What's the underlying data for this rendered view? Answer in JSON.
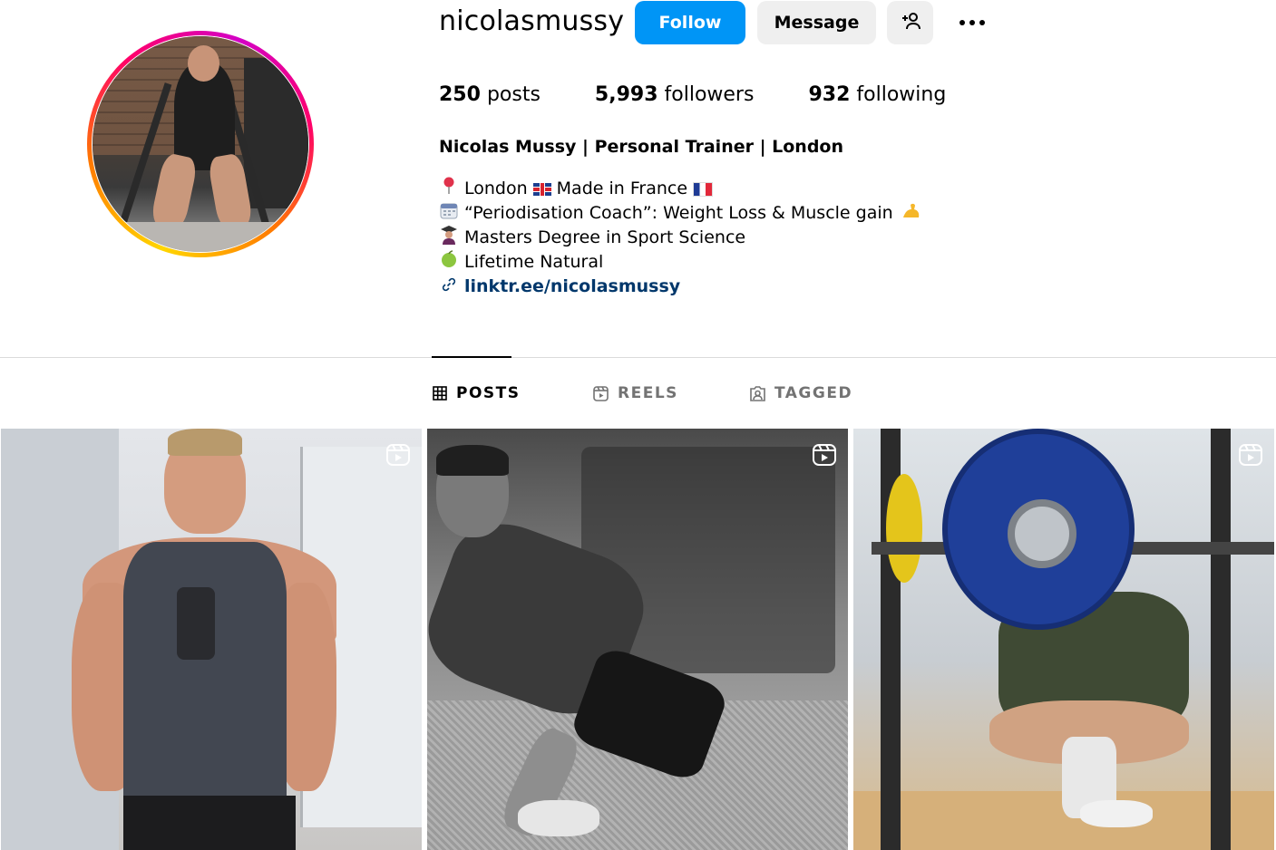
{
  "profile": {
    "username": "nicolasmussy",
    "full_name": "Nicolas Mussy | Personal Trainer | London"
  },
  "actions": {
    "follow": "Follow",
    "message": "Message"
  },
  "stats": [
    {
      "count": "250",
      "label": "posts"
    },
    {
      "count": "5,993",
      "label": "followers"
    },
    {
      "count": "932",
      "label": "following"
    }
  ],
  "bio": {
    "line1_a": "London",
    "line1_b": "Made in France",
    "line2": "“Periodisation Coach”: Weight Loss & Muscle gain",
    "line3": "Masters Degree in Sport Science",
    "line4": "Lifetime Natural",
    "link": "linktr.ee/nicolasmussy"
  },
  "tabs": [
    {
      "label": "POSTS",
      "icon": "grid-icon",
      "active": true
    },
    {
      "label": "REELS",
      "icon": "reels-icon",
      "active": false
    },
    {
      "label": "TAGGED",
      "icon": "tagged-icon",
      "active": false
    }
  ],
  "colors": {
    "follow_button": "#0095f6",
    "secondary_button": "#efefef",
    "link": "#00376b",
    "inactive_tab": "#737373"
  }
}
